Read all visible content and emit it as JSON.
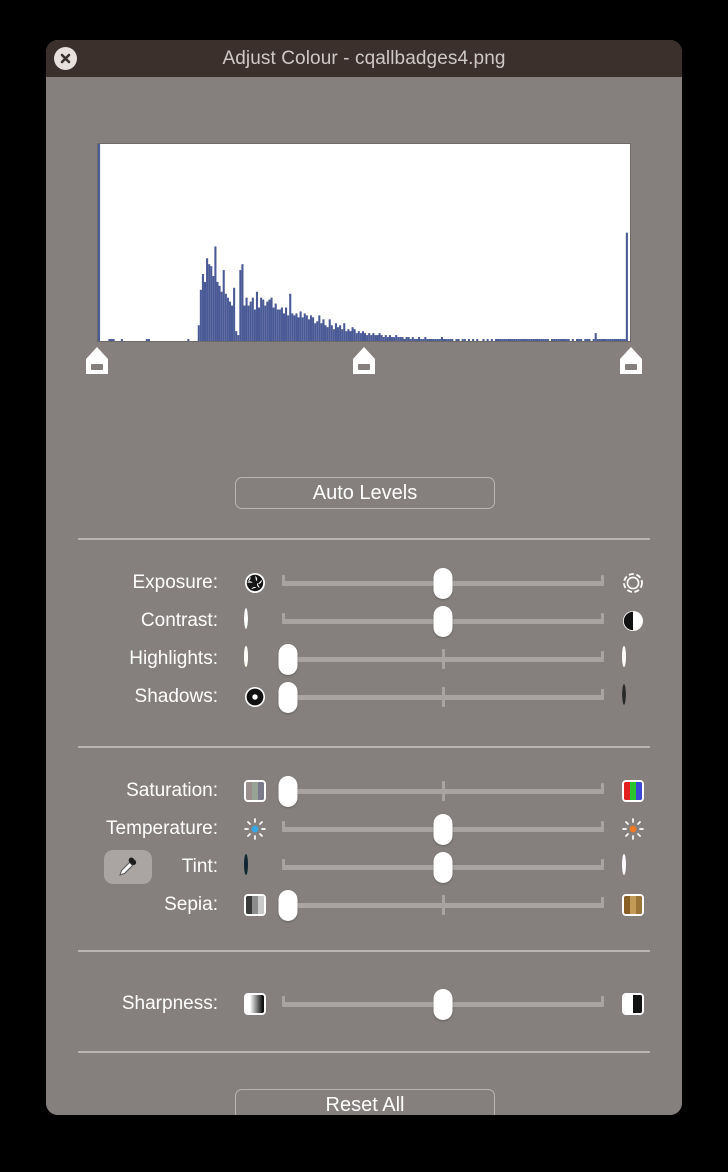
{
  "window": {
    "title": "Adjust Colour - cqallbadges4.png",
    "close_icon": "close-icon",
    "bg_color": "#85807d",
    "titlebar_color": "#3b302c"
  },
  "histogram": {
    "bar_color": "#4a5a96",
    "bg_color": "#ffffff",
    "levels": [
      {
        "name": "black-point",
        "position_pct": 0.0
      },
      {
        "name": "mid-point",
        "position_pct": 50.0
      },
      {
        "name": "white-point",
        "position_pct": 100.0
      }
    ]
  },
  "chart_data": {
    "type": "bar",
    "title": "",
    "xlabel": "",
    "ylabel": "",
    "xlim": [
      0,
      255
    ],
    "ylim": [
      0,
      100
    ],
    "grid": false,
    "legend": "none",
    "categories": [
      0,
      1,
      2,
      3,
      4,
      5,
      6,
      7,
      8,
      9,
      10,
      11,
      12,
      13,
      14,
      15,
      16,
      17,
      18,
      19,
      20,
      21,
      22,
      23,
      24,
      25,
      26,
      27,
      28,
      29,
      30,
      31,
      32,
      33,
      34,
      35,
      36,
      37,
      38,
      39,
      40,
      41,
      42,
      43,
      44,
      45,
      46,
      47,
      48,
      49,
      50,
      51,
      52,
      53,
      54,
      55,
      56,
      57,
      58,
      59,
      60,
      61,
      62,
      63,
      64,
      65,
      66,
      67,
      68,
      69,
      70,
      71,
      72,
      73,
      74,
      75,
      76,
      77,
      78,
      79,
      80,
      81,
      82,
      83,
      84,
      85,
      86,
      87,
      88,
      89,
      90,
      91,
      92,
      93,
      94,
      95,
      96,
      97,
      98,
      99,
      100,
      101,
      102,
      103,
      104,
      105,
      106,
      107,
      108,
      109,
      110,
      111,
      112,
      113,
      114,
      115,
      116,
      117,
      118,
      119,
      120,
      121,
      122,
      123,
      124,
      125,
      126,
      127,
      128,
      129,
      130,
      131,
      132,
      133,
      134,
      135,
      136,
      137,
      138,
      139,
      140,
      141,
      142,
      143,
      144,
      145,
      146,
      147,
      148,
      149,
      150,
      151,
      152,
      153,
      154,
      155,
      156,
      157,
      158,
      159,
      160,
      161,
      162,
      163,
      164,
      165,
      166,
      167,
      168,
      169,
      170,
      171,
      172,
      173,
      174,
      175,
      176,
      177,
      178,
      179,
      180,
      181,
      182,
      183,
      184,
      185,
      186,
      187,
      188,
      189,
      190,
      191,
      192,
      193,
      194,
      195,
      196,
      197,
      198,
      199,
      200,
      201,
      202,
      203,
      204,
      205,
      206,
      207,
      208,
      209,
      210,
      211,
      212,
      213,
      214,
      215,
      216,
      217,
      218,
      219,
      220,
      221,
      222,
      223,
      224,
      225,
      226,
      227,
      228,
      229,
      230,
      231,
      232,
      233,
      234,
      235,
      236,
      237,
      238,
      239,
      240,
      241,
      242,
      243,
      244,
      245,
      246,
      247,
      248,
      249,
      250,
      251,
      252,
      253,
      254,
      255
    ],
    "values": [
      100,
      0,
      0,
      0,
      0,
      1,
      1,
      1,
      0,
      0,
      0,
      1,
      0,
      0,
      0,
      0,
      0,
      0,
      0,
      0,
      0,
      0,
      0,
      1,
      1,
      0,
      0,
      0,
      0,
      0,
      0,
      0,
      0,
      0,
      0,
      0,
      0,
      0,
      0,
      0,
      0,
      0,
      0,
      1,
      0,
      0,
      0,
      0,
      8,
      26,
      34,
      30,
      42,
      39,
      38,
      33,
      48,
      30,
      28,
      25,
      36,
      24,
      22,
      20,
      18,
      27,
      5,
      3,
      36,
      39,
      18,
      22,
      18,
      20,
      22,
      16,
      25,
      17,
      22,
      21,
      18,
      20,
      21,
      22,
      17,
      19,
      16,
      16,
      17,
      14,
      17,
      13,
      24,
      14,
      13,
      14,
      12,
      15,
      12,
      14,
      13,
      11,
      13,
      12,
      9,
      10,
      13,
      9,
      11,
      8,
      7,
      11,
      8,
      6,
      9,
      7,
      8,
      6,
      9,
      5,
      6,
      5,
      7,
      6,
      4,
      5,
      4,
      5,
      4,
      3,
      4,
      3,
      4,
      3,
      3,
      4,
      3,
      2,
      3,
      2,
      3,
      2,
      2,
      3,
      2,
      2,
      2,
      1,
      2,
      2,
      1,
      2,
      1,
      1,
      2,
      1,
      1,
      2,
      1,
      1,
      1,
      1,
      1,
      1,
      1,
      2,
      1,
      1,
      1,
      1,
      1,
      0,
      1,
      1,
      0,
      1,
      1,
      0,
      1,
      0,
      1,
      0,
      1,
      0,
      0,
      1,
      0,
      1,
      0,
      1,
      0,
      1,
      1,
      1,
      1,
      1,
      1,
      1,
      1,
      1,
      1,
      1,
      1,
      1,
      1,
      1,
      1,
      1,
      1,
      1,
      1,
      1,
      1,
      1,
      1,
      1,
      1,
      0,
      1,
      1,
      1,
      1,
      1,
      1,
      1,
      1,
      1,
      0,
      1,
      0,
      1,
      1,
      1,
      0,
      1,
      1,
      1,
      0,
      1,
      4,
      1,
      1,
      1,
      1,
      1,
      1,
      1,
      1,
      1,
      1,
      1,
      1,
      1,
      1,
      55
    ]
  },
  "buttons": {
    "auto_levels": "Auto Levels",
    "reset_all": "Reset All"
  },
  "groups": [
    {
      "name": "tone",
      "rows": [
        {
          "label": "Exposure:",
          "value_pct": 50,
          "icon_left": "aperture-dark-icon",
          "icon_right": "aperture-light-icon"
        },
        {
          "label": "Contrast:",
          "value_pct": 50,
          "icon_left": "circle-black-icon",
          "icon_right": "circle-half-icon"
        },
        {
          "label": "Highlights:",
          "value_pct": 2,
          "icon_left": "circle-yellow-icon",
          "icon_right": "circle-olive-icon"
        },
        {
          "label": "Shadows:",
          "value_pct": 2,
          "icon_left": "circle-black-dot-icon",
          "icon_right": "circle-white-icon"
        }
      ]
    },
    {
      "name": "colour",
      "rows": [
        {
          "label": "Saturation:",
          "value_pct": 2,
          "icon_left": "swatch-desaturated-icon",
          "icon_right": "swatch-rgb-icon"
        },
        {
          "label": "Temperature:",
          "value_pct": 50,
          "icon_left": "sun-blue-icon",
          "icon_right": "sun-orange-icon"
        },
        {
          "label": "Tint:",
          "value_pct": 50,
          "icon_left": "circle-green-icon",
          "icon_right": "circle-magenta-icon",
          "eyedropper": "eyedropper-icon"
        },
        {
          "label": "Sepia:",
          "value_pct": 2,
          "icon_left": "swatch-gray-icon",
          "icon_right": "swatch-sepia-icon"
        }
      ]
    },
    {
      "name": "detail",
      "rows": [
        {
          "label": "Sharpness:",
          "value_pct": 50,
          "icon_left": "gradient-soft-icon",
          "icon_right": "gradient-sharp-icon"
        }
      ]
    }
  ]
}
